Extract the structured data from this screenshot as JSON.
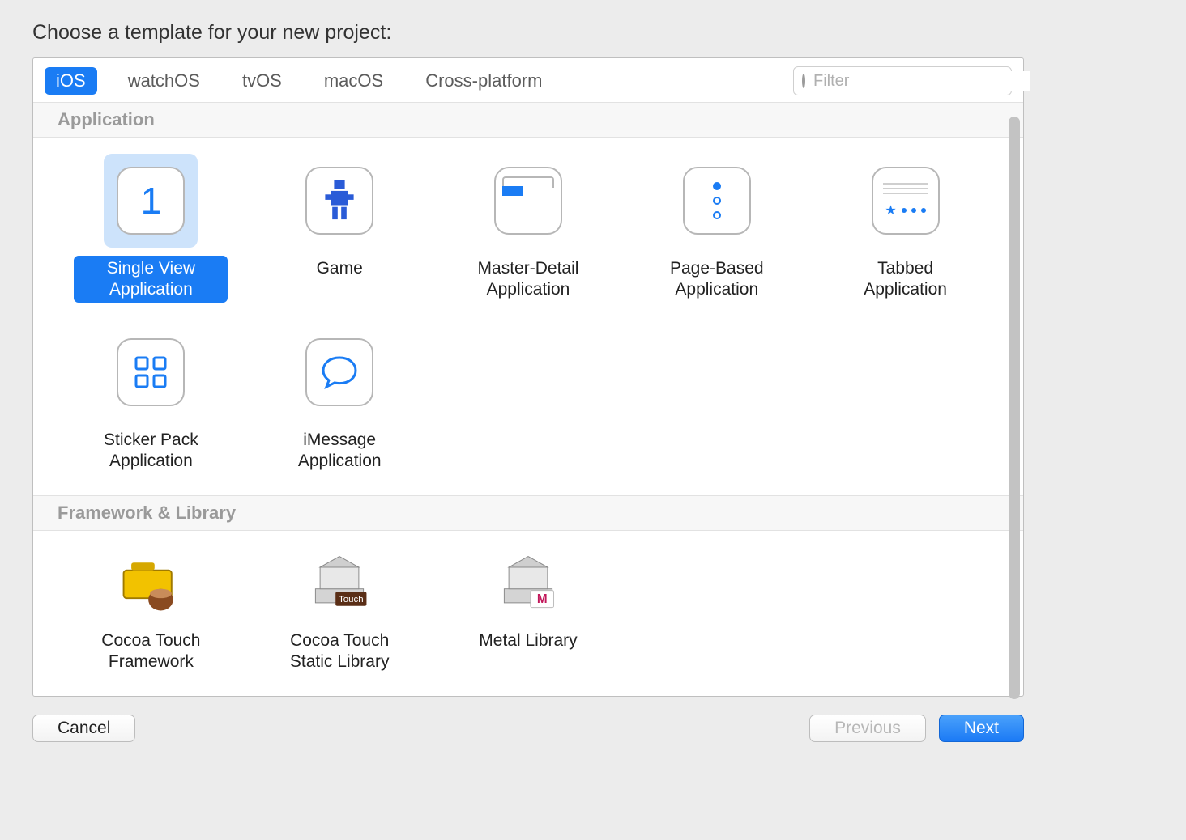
{
  "header": {
    "title": "Choose a template for your new project:"
  },
  "platforms": {
    "items": [
      "iOS",
      "watchOS",
      "tvOS",
      "macOS",
      "Cross-platform"
    ],
    "selected": "iOS"
  },
  "filter": {
    "placeholder": "Filter",
    "value": ""
  },
  "sections": [
    {
      "title": "Application",
      "templates": [
        {
          "id": "single-view",
          "label": "Single View Application",
          "selected": true,
          "icon": "digit-one-icon"
        },
        {
          "id": "game",
          "label": "Game",
          "selected": false,
          "icon": "robot-icon"
        },
        {
          "id": "master-detail",
          "label": "Master-Detail Application",
          "selected": false,
          "icon": "master-detail-icon"
        },
        {
          "id": "page-based",
          "label": "Page-Based Application",
          "selected": false,
          "icon": "page-dots-icon"
        },
        {
          "id": "tabbed",
          "label": "Tabbed Application",
          "selected": false,
          "icon": "tab-bar-icon"
        },
        {
          "id": "sticker-pack",
          "label": "Sticker Pack Application",
          "selected": false,
          "icon": "grid-2x2-icon"
        },
        {
          "id": "imessage",
          "label": "iMessage Application",
          "selected": false,
          "icon": "speech-bubble-icon"
        }
      ]
    },
    {
      "title": "Framework & Library",
      "templates": [
        {
          "id": "cocoa-touch-framework",
          "label": "Cocoa Touch Framework",
          "selected": false,
          "icon": "toolbox-icon"
        },
        {
          "id": "cocoa-touch-static",
          "label": "Cocoa Touch Static Library",
          "selected": false,
          "icon": "library-touch-icon"
        },
        {
          "id": "metal-library",
          "label": "Metal Library",
          "selected": false,
          "icon": "library-metal-icon"
        }
      ]
    }
  ],
  "buttons": {
    "cancel": "Cancel",
    "previous": "Previous",
    "next": "Next"
  }
}
